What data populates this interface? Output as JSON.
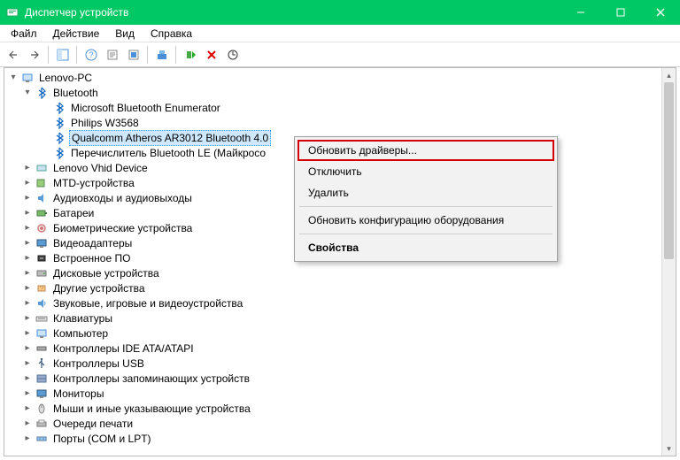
{
  "window": {
    "title": "Диспетчер устройств"
  },
  "menu": {
    "file": "Файл",
    "action": "Действие",
    "view": "Вид",
    "help": "Справка"
  },
  "tree": {
    "root": "Lenovo-PC",
    "bluetooth": "Bluetooth",
    "bt1": "Microsoft Bluetooth Enumerator",
    "bt2": "Philips W3568",
    "bt3": "Qualcomm Atheros AR3012 Bluetooth 4.0",
    "bt4": "Перечислитель Bluetooth LE (Майкросо",
    "cat": {
      "vhid": "Lenovo Vhid Device",
      "mtd": "MTD-устройства",
      "audio": "Аудиовходы и аудиовыходы",
      "battery": "Батареи",
      "biometric": "Биометрические устройства",
      "display": "Видеоадаптеры",
      "firmware": "Встроенное ПО",
      "disk": "Дисковые устройства",
      "other": "Другие устройства",
      "sound": "Звуковые, игровые и видеоустройства",
      "keyboard": "Клавиатуры",
      "computer": "Компьютер",
      "ide": "Контроллеры IDE ATA/ATAPI",
      "usb": "Контроллеры USB",
      "storage": "Контроллеры запоминающих устройств",
      "monitor": "Мониторы",
      "mice": "Мыши и иные указывающие устройства",
      "print": "Очереди печати",
      "ports": "Порты (COM и LPT)"
    }
  },
  "context": {
    "update": "Обновить драйверы...",
    "disable": "Отключить",
    "delete": "Удалить",
    "scan": "Обновить конфигурацию оборудования",
    "properties": "Свойства"
  }
}
